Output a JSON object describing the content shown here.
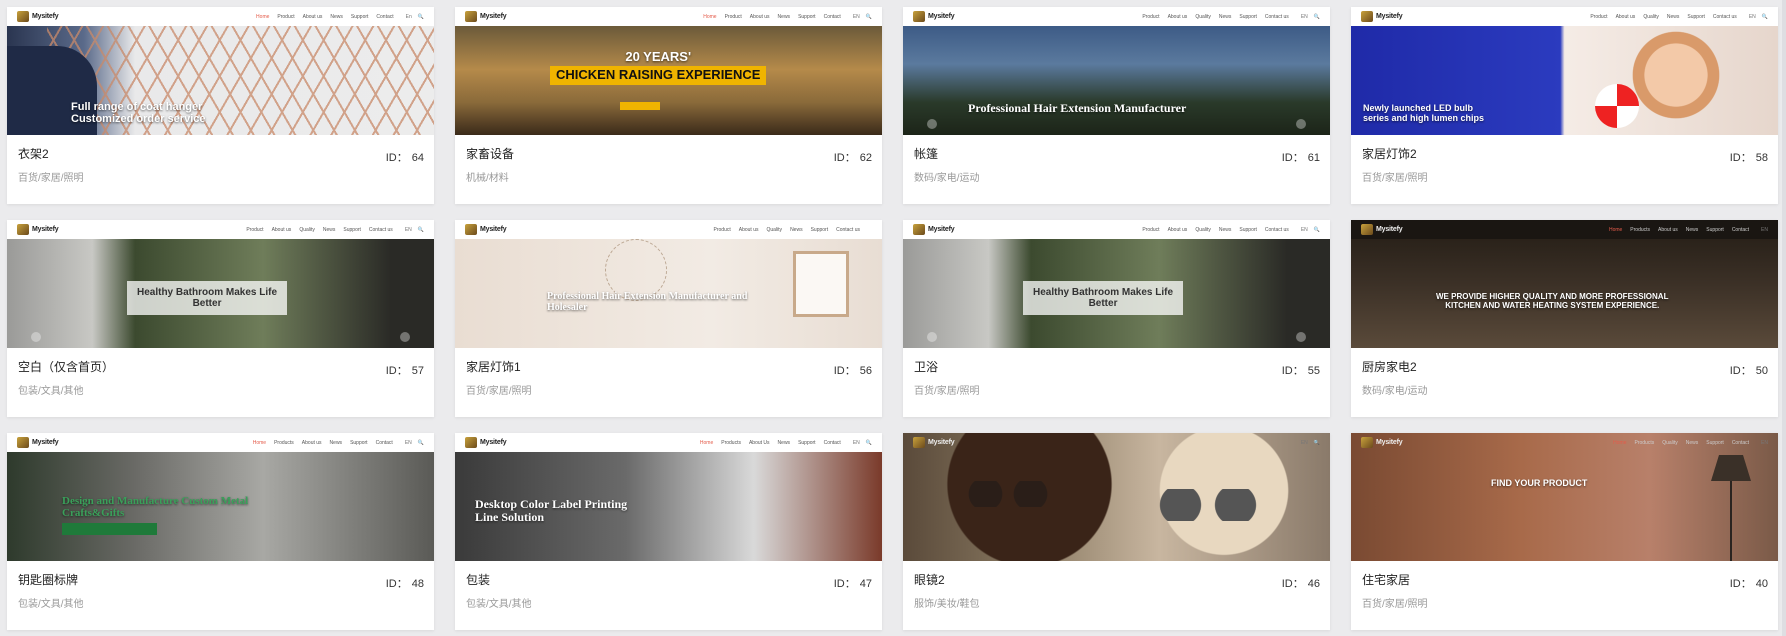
{
  "templates": [
    {
      "title": "衣架2",
      "id_label": "ID：",
      "id": "64",
      "category": "百货/家居/照明",
      "preview": {
        "logo": "Mysitefy",
        "nav": [
          "Home",
          "Product",
          "About us",
          "News",
          "Support",
          "Contact"
        ],
        "tools": [
          "En",
          "🔍"
        ],
        "caption": "Full range of coat hanger\nCustomized order service"
      }
    },
    {
      "title": "家畜设备",
      "id_label": "ID：",
      "id": "62",
      "category": "机械/材料",
      "preview": {
        "logo": "Mysitefy",
        "nav": [
          "Home",
          "Product",
          "About us",
          "News",
          "Support",
          "Contact"
        ],
        "tools": [
          "EN",
          "🔍"
        ],
        "caption": "20 YEARS'\nCHICKEN RAISING EXPERIENCE"
      }
    },
    {
      "title": "帐篷",
      "id_label": "ID：",
      "id": "61",
      "category": "数码/家电/运动",
      "preview": {
        "logo": "Mysitefy",
        "nav": [
          "Product",
          "About us",
          "Quality",
          "News",
          "Support",
          "Contact us"
        ],
        "tools": [
          "EN",
          "🔍"
        ],
        "caption": "Professional Hair Extension Manufacturer"
      }
    },
    {
      "title": "家居灯饰2",
      "id_label": "ID：",
      "id": "58",
      "category": "百货/家居/照明",
      "preview": {
        "logo": "Mysitefy",
        "nav": [
          "Product",
          "About us",
          "Quality",
          "News",
          "Support",
          "Contact us"
        ],
        "tools": [
          "EN",
          "🔍"
        ],
        "caption": "Newly launched LED bulb\nseries and high lumen chips"
      }
    },
    {
      "title": "空白（仅含首页）",
      "id_label": "ID：",
      "id": "57",
      "category": "包装/文具/其他",
      "preview": {
        "logo": "Mysitefy",
        "nav": [
          "Product",
          "About us",
          "Quality",
          "News",
          "Support",
          "Contact us"
        ],
        "tools": [
          "EN",
          "🔍"
        ],
        "caption": "Healthy Bathroom Makes Life\nBetter"
      }
    },
    {
      "title": "家居灯饰1",
      "id_label": "ID：",
      "id": "56",
      "category": "百货/家居/照明",
      "preview": {
        "logo": "Mysitefy",
        "nav": [
          "Product",
          "About us",
          "Quality",
          "News",
          "Support",
          "Contact us"
        ],
        "tools": [],
        "caption": "Professional Hair Extension Manufacturer and\nHolesaler"
      }
    },
    {
      "title": "卫浴",
      "id_label": "ID：",
      "id": "55",
      "category": "百货/家居/照明",
      "preview": {
        "logo": "Mysitefy",
        "nav": [
          "Product",
          "About us",
          "Quality",
          "News",
          "Support",
          "Contact us"
        ],
        "tools": [
          "EN",
          "🔍"
        ],
        "caption": "Healthy Bathroom Makes Life\nBetter"
      }
    },
    {
      "title": "厨房家电2",
      "id_label": "ID：",
      "id": "50",
      "category": "数码/家电/运动",
      "preview": {
        "logo": "Mysitefy",
        "nav": [
          "Home",
          "Products",
          "About us",
          "News",
          "Support",
          "Contact"
        ],
        "tools": [
          "EN"
        ],
        "caption": "WE PROVIDE HIGHER QUALITY AND MORE PROFESSIONAL\nKITCHEN AND WATER HEATING SYSTEM EXPERIENCE."
      }
    },
    {
      "title": "钥匙圈标牌",
      "id_label": "ID：",
      "id": "48",
      "category": "包装/文具/其他",
      "preview": {
        "logo": "Mysitefy",
        "nav": [
          "Home",
          "Products",
          "About us",
          "News",
          "Support",
          "Contact"
        ],
        "tools": [
          "EN",
          "🔍"
        ],
        "caption": "Design and Manufacture Custom Metal\nCrafts&Gifts"
      }
    },
    {
      "title": "包装",
      "id_label": "ID：",
      "id": "47",
      "category": "包装/文具/其他",
      "preview": {
        "logo": "Mysitefy",
        "nav": [
          "Home",
          "Products",
          "About Us",
          "News",
          "Support",
          "Contact"
        ],
        "tools": [
          "EN",
          "🔍"
        ],
        "caption": "Desktop Color Label Printing\nLine Solution"
      }
    },
    {
      "title": "眼镜2",
      "id_label": "ID：",
      "id": "46",
      "category": "服饰/美妆/鞋包",
      "preview": {
        "logo": "Mysitefy",
        "nav": [],
        "tools": [
          "EN",
          "🔍"
        ],
        "caption": ""
      }
    },
    {
      "title": "住宅家居",
      "id_label": "ID：",
      "id": "40",
      "category": "百货/家居/照明",
      "preview": {
        "logo": "Mysitefy",
        "nav": [
          "Home",
          "Products",
          "Quality",
          "News",
          "Support",
          "Contact"
        ],
        "tools": [
          "EN"
        ],
        "caption": "FIND YOUR PRODUCT"
      }
    }
  ],
  "colors": {
    "page_bg": "#ebebed",
    "card_bg": "#ffffff",
    "title": "#222222",
    "category": "#999999",
    "nav_active": "#e45b4a"
  }
}
